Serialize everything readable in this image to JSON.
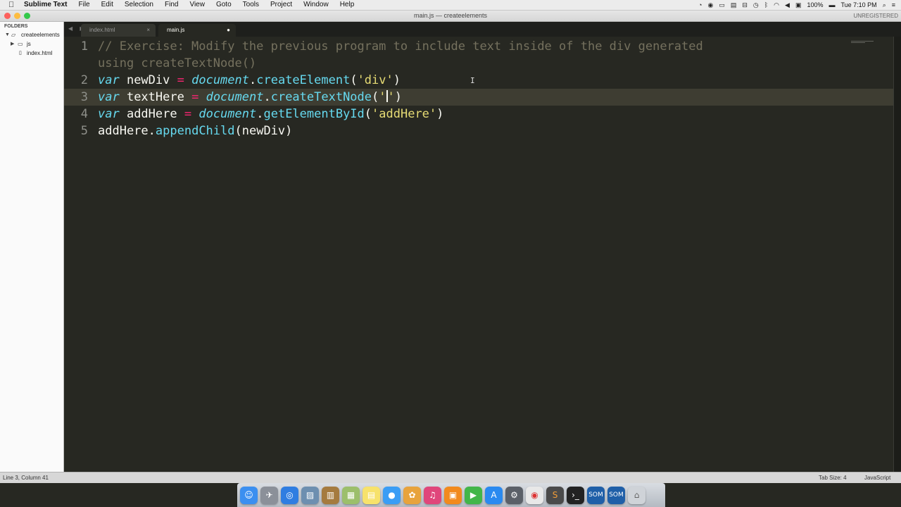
{
  "menubar": {
    "apple_icon": "",
    "app": "Sublime Text",
    "items": [
      "File",
      "Edit",
      "Selection",
      "Find",
      "View",
      "Goto",
      "Tools",
      "Project",
      "Window",
      "Help"
    ],
    "battery": "100%",
    "clock": "Tue 7:10 PM"
  },
  "window": {
    "title": "main.js — createelements",
    "unregistered": "UNREGISTERED"
  },
  "sidebar": {
    "header": "FOLDERS",
    "root": "createelements",
    "folder": "js",
    "file": "index.html"
  },
  "tabs": [
    {
      "label": "index.html",
      "close": "×"
    },
    {
      "label": "main.js",
      "close": "●"
    }
  ],
  "editor": {
    "line_numbers": [
      "1",
      "2",
      "3",
      "4",
      "5"
    ],
    "line1": {
      "comment_a": "// Exercise: Modify the previous program to include text inside of the div generated",
      "comment_b": "using createTextNode()"
    },
    "line2": {
      "kw": "var",
      "name": " newDiv ",
      "op": "=",
      "sp": " ",
      "obj": "document",
      "dot": ".",
      "fn": "createElement",
      "open": "(",
      "str": "'div'",
      "close": ")"
    },
    "line3": {
      "kw": "var",
      "name": " textHere ",
      "op": "=",
      "sp": " ",
      "obj": "document",
      "dot": ".",
      "fn": "createTextNode",
      "open": "(",
      "str_a": "'",
      "str_b": "'",
      "close": ")"
    },
    "line4": {
      "kw": "var",
      "name": " addHere ",
      "op": "=",
      "sp": " ",
      "obj": "document",
      "dot": ".",
      "fn": "getElementById",
      "open": "(",
      "str": "'addHere'",
      "close": ")"
    },
    "line5": {
      "obj": "addHere",
      "dot": ".",
      "fn": "appendChild",
      "args": "(newDiv)"
    }
  },
  "statusbar": {
    "position": "Line 3, Column 41",
    "tab_size": "Tab Size: 4",
    "syntax": "JavaScript"
  },
  "dock": {
    "icons": [
      "finder-icon",
      "launchpad-icon",
      "safari-icon",
      "preview-icon",
      "contacts-icon",
      "photos-icon",
      "notes-icon",
      "messages-icon",
      "photos-app-icon",
      "itunes-icon",
      "ibooks-icon",
      "facetime-icon",
      "app-store-icon",
      "system-preferences-icon",
      "chrome-icon",
      "sublime-text-icon",
      "terminal-icon",
      "som-icon",
      "som-icon-2",
      "trash-icon"
    ]
  }
}
